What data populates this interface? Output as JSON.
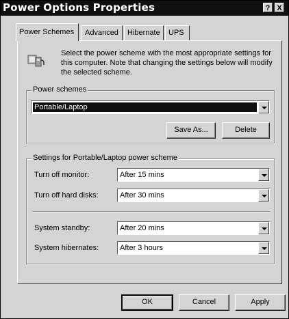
{
  "window": {
    "title": "Power Options Properties",
    "help_glyph": "?",
    "close_glyph": "X"
  },
  "tabs": [
    {
      "label": "Power Schemes",
      "active": true
    },
    {
      "label": "Advanced",
      "active": false
    },
    {
      "label": "Hibernate",
      "active": false
    },
    {
      "label": "UPS",
      "active": false
    }
  ],
  "intro": {
    "icon": "power-scheme-icon",
    "text": "Select the power scheme with the most appropriate settings for this computer. Note that changing the settings below will modify the selected scheme."
  },
  "power_schemes": {
    "group_label": "Power schemes",
    "selected": "Portable/Laptop",
    "save_as_label": "Save As...",
    "delete_label": "Delete"
  },
  "settings": {
    "group_label": "Settings for Portable/Laptop power scheme",
    "monitor_label": "Turn off monitor:",
    "monitor_value": "After 15 mins",
    "hard_disks_label": "Turn off hard disks:",
    "hard_disks_value": "After 30 mins",
    "standby_label": "System standby:",
    "standby_value": "After 20 mins",
    "hibernates_label": "System hibernates:",
    "hibernates_value": "After 3 hours"
  },
  "footer": {
    "ok_label": "OK",
    "cancel_label": "Cancel",
    "apply_label": "Apply"
  }
}
